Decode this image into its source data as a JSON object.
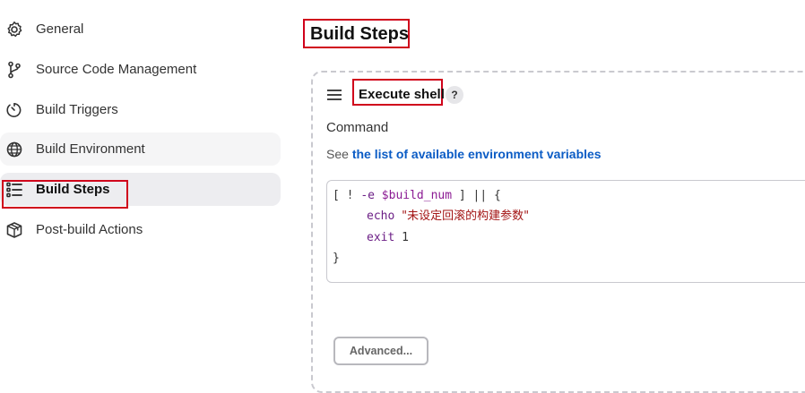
{
  "sidebar": {
    "items": [
      {
        "label": "General",
        "icon": "gear-icon"
      },
      {
        "label": "Source Code Management",
        "icon": "branch-icon"
      },
      {
        "label": "Build Triggers",
        "icon": "timer-icon"
      },
      {
        "label": "Build Environment",
        "icon": "globe-icon"
      },
      {
        "label": "Build Steps",
        "icon": "list-icon",
        "active": true
      },
      {
        "label": "Post-build Actions",
        "icon": "package-icon"
      }
    ]
  },
  "main": {
    "title": "Build Steps",
    "step": {
      "title": "Execute shell",
      "help": "?",
      "command_label": "Command",
      "see_prefix": "See ",
      "see_link": "the list of available environment variables",
      "code": {
        "line1_open": "[ ! ",
        "line1_flag": "-e ",
        "line1_var": "$build_num",
        "line1_close": " ] || {",
        "line2_cmd": "echo",
        "line2_str": "\"未设定回滚的构建参数\"",
        "line3_cmd": "exit",
        "line3_num": " 1",
        "line4": "}"
      },
      "advanced_label": "Advanced..."
    }
  },
  "colors": {
    "highlight_border": "#d0021b",
    "link": "#0b5cc5",
    "active_bg": "#ededf0"
  }
}
